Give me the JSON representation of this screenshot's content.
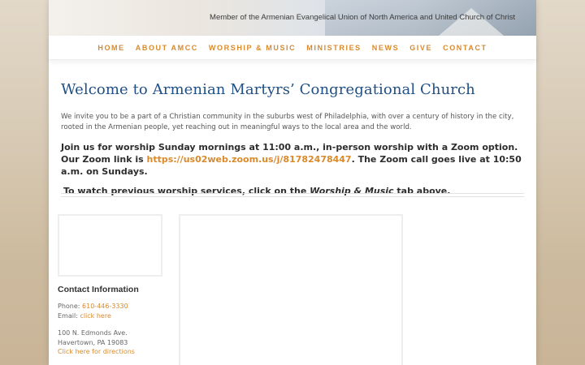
{
  "header": {
    "affiliation": "Member of the Armenian Evangelical Union of North America and United Church of Christ"
  },
  "nav": {
    "items": [
      "HOME",
      "ABOUT AMCC",
      "WORSHIP & MUSIC",
      "MINISTRIES",
      "NEWS",
      "GIVE",
      "CONTACT"
    ]
  },
  "main": {
    "title": "Welcome to Armenian Martyrs’ Congregational Church",
    "intro": "We invite you to be a part of a Christian community in the suburbs west of Philadelphia, with over a century of history in the city, rooted in the Armenian people, yet reaching out in meaningful ways to the local area and the world.",
    "join_text_1": "Join us for worship Sunday mornings at 11:00 a.m., in-person worship with a Zoom option. Our Zoom link is ",
    "zoom_link": "https://us02web.zoom.us/j/81782478447",
    "join_text_2": ". The Zoom call goes live at 10:50 a.m. on Sundays.",
    "watch_text_1": "To watch previous worship services, click on the ",
    "watch_emphasis": "Worship & Music",
    "watch_text_2": " tab above."
  },
  "contact": {
    "title": "Contact Information",
    "phone_label": "Phone: ",
    "phone": "610-446-3330",
    "email_label": "Email: ",
    "email_link": "click here",
    "address_line1": "100 N. Edmonds Ave.",
    "address_line2": "Havertown, PA 19083",
    "directions_link": "Click here for directions"
  },
  "colors": {
    "accent": "#d98a2b",
    "title_blue": "#1e4f86"
  }
}
